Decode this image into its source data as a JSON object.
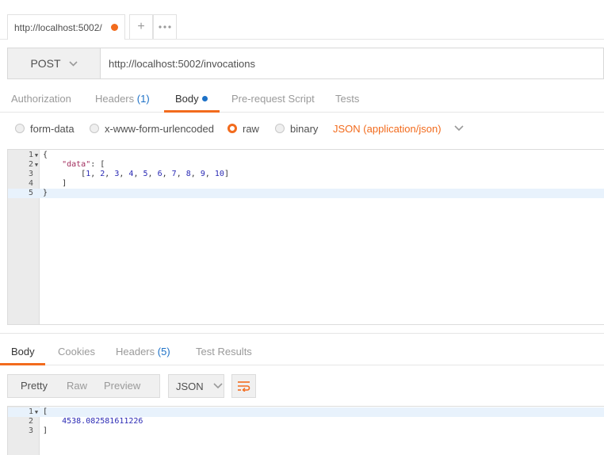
{
  "tab": {
    "title": "http://localhost:5002/"
  },
  "request": {
    "method": "POST",
    "url": "http://localhost:5002/invocations",
    "tabs": [
      "Authorization",
      "Headers",
      "Body",
      "Pre-request Script",
      "Tests"
    ],
    "headers_count": "(1)"
  },
  "body_types": [
    "form-data",
    "x-www-form-urlencoded",
    "raw",
    "binary"
  ],
  "content_type": "JSON (application/json)",
  "request_body_lines": {
    "l1": "{",
    "l2_key": "\"data\"",
    "l2_rest": ": [",
    "l3_nums": [
      "1",
      "2",
      "3",
      "4",
      "5",
      "6",
      "7",
      "8",
      "9",
      "10"
    ],
    "l4": "    ]",
    "l5": "}"
  },
  "response": {
    "tabs": [
      "Body",
      "Cookies",
      "Headers",
      "Test Results"
    ],
    "headers_count": "(5)",
    "views": [
      "Pretty",
      "Raw",
      "Preview"
    ],
    "format": "JSON",
    "body_lines": {
      "l1": "[",
      "l2": "4538.082581611226",
      "l3": "]"
    }
  },
  "colors": {
    "accent": "#f26b1d",
    "link": "#1d71c7"
  }
}
